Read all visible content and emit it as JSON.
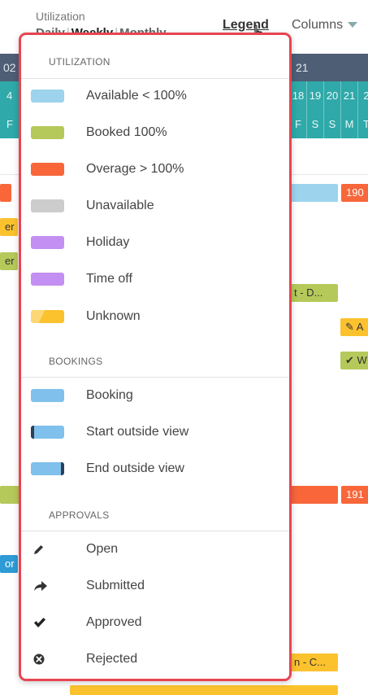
{
  "header": {
    "utilization_label": "Utilization",
    "view_tabs": [
      "Daily",
      "Weekly",
      "Monthly"
    ],
    "legend_link": "Legend",
    "columns_link": "Columns"
  },
  "calendar": {
    "partial_year_left": "02",
    "partial_week_number": "21",
    "partial_date_left": "4",
    "partial_day_left": "F",
    "dates": [
      "18",
      "19",
      "20",
      "21",
      "2"
    ],
    "weekdays": [
      "F",
      "S",
      "S",
      "M",
      "T"
    ]
  },
  "background_bars": {
    "bar_190": "190",
    "bar_191": "191",
    "text_fragment_1": "er",
    "text_fragment_2": "er",
    "text_fragment_3": "t - D...",
    "text_fragment_4": "A",
    "text_fragment_5": "W",
    "text_fragment_6": "or",
    "text_fragment_7": "n - C..."
  },
  "legend": {
    "utilization": {
      "heading": "UTILIZATION",
      "items": [
        {
          "label": "Available < 100%",
          "color": "#9dd3ec"
        },
        {
          "label": "Booked 100%",
          "color": "#b5c95a"
        },
        {
          "label": "Overage > 100%",
          "color": "#f8663a"
        },
        {
          "label": "Unavailable",
          "color": "#cccccc"
        },
        {
          "label": "Holiday",
          "color": "#c38ff2"
        },
        {
          "label": "Time off",
          "color": "#c38ff2"
        },
        {
          "label": "Unknown",
          "color": "#fbc22e"
        }
      ]
    },
    "bookings": {
      "heading": "BOOKINGS",
      "items": [
        {
          "label": "Booking",
          "color": "#7fc0ec"
        },
        {
          "label": "Start outside view",
          "color": "#7fc0ec"
        },
        {
          "label": "End outside view",
          "color": "#7fc0ec"
        }
      ]
    },
    "approvals": {
      "heading": "APPROVALS",
      "items": [
        {
          "label": "Open",
          "icon": "pencil-icon"
        },
        {
          "label": "Submitted",
          "icon": "forward-arrow-icon"
        },
        {
          "label": "Approved",
          "icon": "checkmark-icon"
        },
        {
          "label": "Rejected",
          "icon": "x-circle-icon"
        }
      ]
    }
  }
}
